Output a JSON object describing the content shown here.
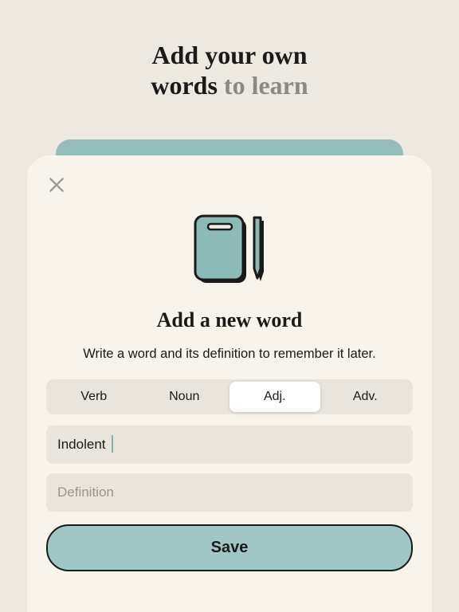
{
  "header": {
    "line1": "Add your own",
    "line2_bold": "words",
    "line2_muted": " to learn"
  },
  "modal": {
    "title": "Add a new word",
    "subtitle": "Write a word and its definition to remember it later.",
    "segments": {
      "verb": "Verb",
      "noun": "Noun",
      "adj": "Adj.",
      "adv": "Adv."
    },
    "word_value": "Indolent",
    "definition_placeholder": "Definition",
    "save_label": "Save"
  },
  "icons": {
    "close": "close-icon",
    "notebook": "notebook-pencil-icon"
  }
}
